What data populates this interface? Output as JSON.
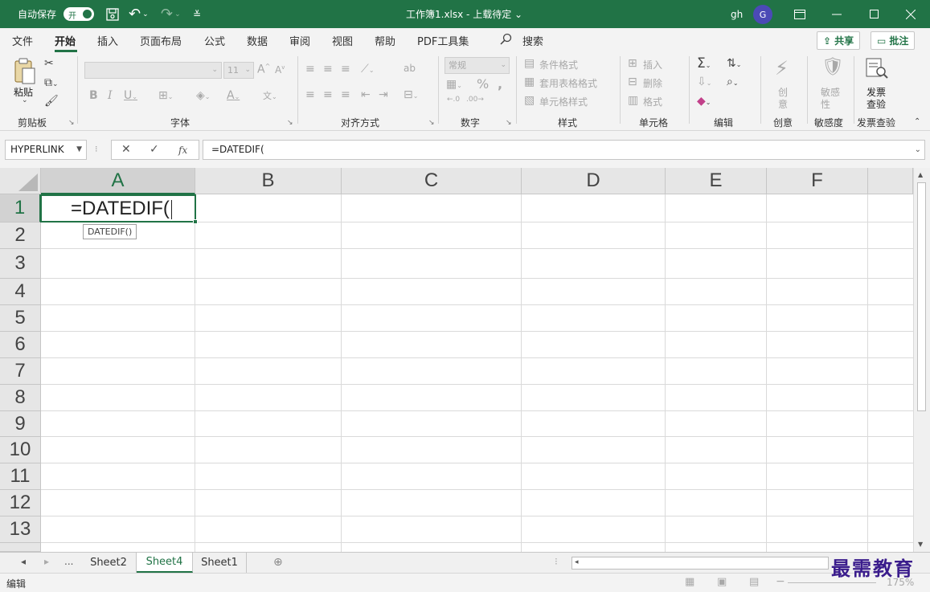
{
  "titlebar": {
    "autosave_label": "自动保存",
    "autosave_state": "开",
    "title": "工作簿1.xlsx  -  上载待定 ⌄",
    "user_initials": "gh",
    "avatar_letter": "G"
  },
  "tabs": [
    "文件",
    "开始",
    "插入",
    "页面布局",
    "公式",
    "数据",
    "审阅",
    "视图",
    "帮助",
    "PDF工具集"
  ],
  "search_label": "搜索",
  "share_label": "共享",
  "comment_label": "批注",
  "ribbon": {
    "paste_label": "粘贴",
    "font_size": "11",
    "number_format": "常规",
    "conditional_format": "条件格式",
    "table_format": "套用表格格式",
    "cell_style": "单元格样式",
    "insert": "插入",
    "delete": "删除",
    "format": "格式",
    "creative_l1": "创",
    "creative_l2": "意",
    "sensitivity_l1": "敏感",
    "sensitivity_l2": "性",
    "invoice_l1": "发票",
    "invoice_l2": "查验",
    "groups": {
      "clipboard": "剪贴板",
      "font": "字体",
      "alignment": "对齐方式",
      "number": "数字",
      "styles": "样式",
      "cells": "单元格",
      "editing": "编辑",
      "creative": "创意",
      "sensitivity": "敏感度",
      "invoice": "发票查验"
    }
  },
  "formula_bar": {
    "name_box": "HYPERLINK",
    "fx": "fx",
    "formula": "=DATEDIF("
  },
  "grid": {
    "columns": [
      "A",
      "B",
      "C",
      "D",
      "E",
      "F"
    ],
    "rows": [
      "1",
      "2",
      "3",
      "4",
      "5",
      "6",
      "7",
      "8",
      "9",
      "10",
      "11",
      "12",
      "13"
    ],
    "active_cell_value": "=DATEDIF(",
    "tooltip": "DATEDIF()"
  },
  "sheets": {
    "ellipsis": "...",
    "tabs": [
      "Sheet2",
      "Sheet4",
      "Sheet1"
    ],
    "active": "Sheet4"
  },
  "status": {
    "mode": "编辑",
    "zoom": "175%"
  },
  "watermark": "最需教育",
  "colors": {
    "accent": "#217346"
  }
}
